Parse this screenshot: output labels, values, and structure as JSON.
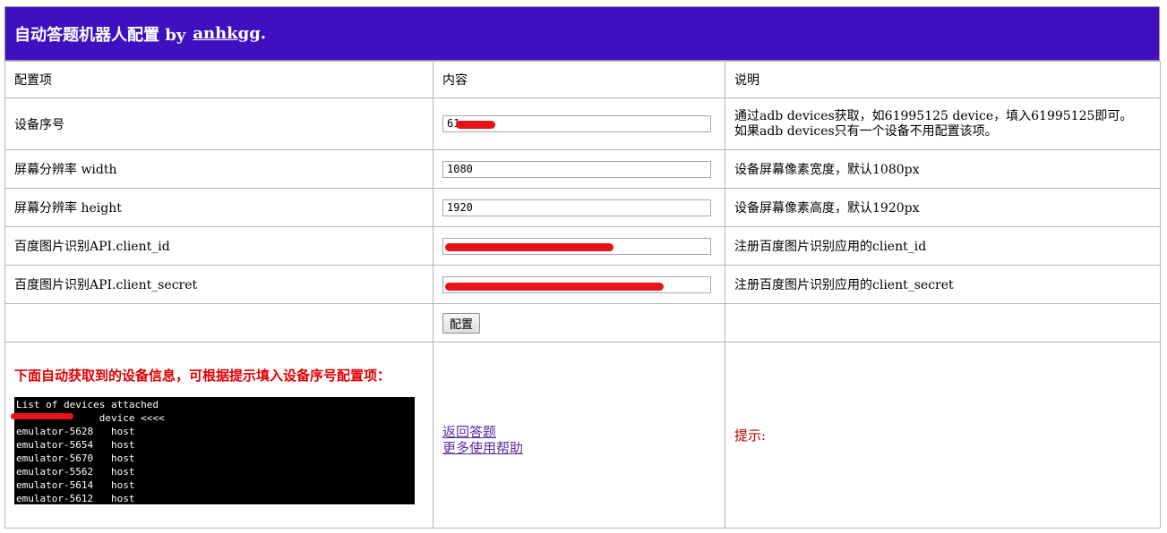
{
  "header": {
    "title": "自动答题机器人配置 by",
    "author": "anhkgg",
    "suffix": "."
  },
  "table": {
    "columns": [
      "配置项",
      "内容",
      "说明"
    ],
    "rows": [
      {
        "label": "设备序号",
        "value": "61",
        "desc": "通过adb devices获取，如61995125 device，填入61995125即可。\n如果adb devices只有一个设备不用配置该项。"
      },
      {
        "label": "屏幕分辨率 width",
        "value": "1080",
        "desc": "设备屏幕像素宽度，默认1080px"
      },
      {
        "label": "屏幕分辨率 height",
        "value": "1920",
        "desc": "设备屏幕像素高度，默认1920px"
      },
      {
        "label": "百度图片识别API.client_id",
        "value": "",
        "desc": "注册百度图片识别应用的client_id"
      },
      {
        "label": "百度图片识别API.client_secret",
        "value": "",
        "desc": "注册百度图片识别应用的client_secret"
      }
    ],
    "submit_label": "配置"
  },
  "devices": {
    "title": "下面自动获取到的设备信息，可根据提示填入设备序号配置项：",
    "lines": [
      "List of devices attached",
      "              device <<<<",
      "emulator-5628   host",
      "emulator-5654   host",
      "emulator-5670   host",
      "emulator-5562   host",
      "emulator-5614   host",
      "emulator-5612   host"
    ]
  },
  "links": {
    "back": "返回答题",
    "help": "更多使用帮助"
  },
  "hint": "提示:"
}
